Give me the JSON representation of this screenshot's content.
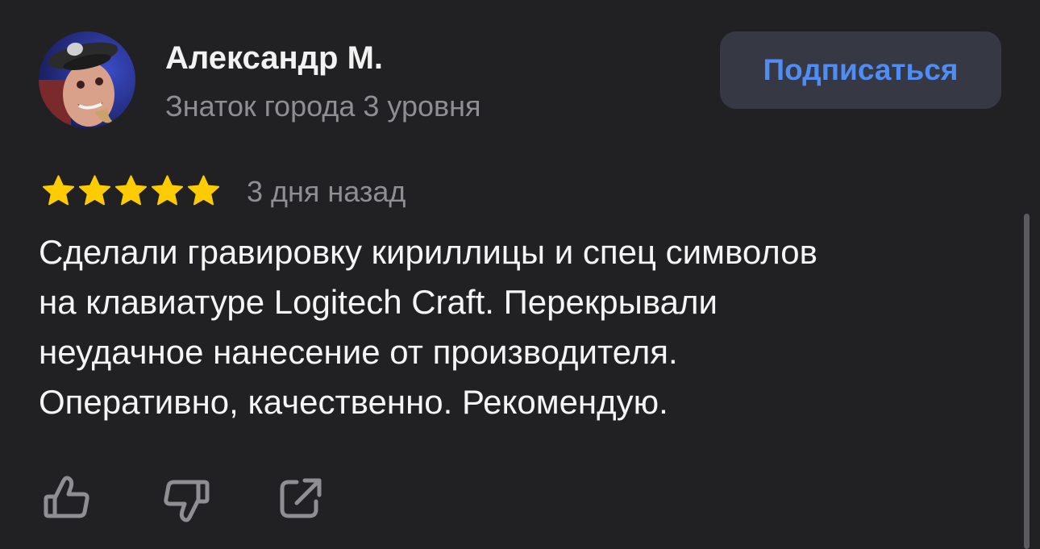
{
  "author": {
    "name": "Александр М.",
    "level": "Знаток города 3 уровня",
    "avatar_icon": "user-avatar-photo"
  },
  "subscribe_button": {
    "label": "Подписаться",
    "color": "#4f8df5"
  },
  "review": {
    "rating": 5,
    "rating_max": 5,
    "star_color": "#fccc00",
    "date": "3 дня назад",
    "text_lines": [
      "Сделали гравировку кириллицы и спец символов",
      "на клавиатуре Logitech Craft. Перекрывали",
      "неудачное нанесение от производителя.",
      "Оперативно, качественно. Рекомендую."
    ]
  },
  "actions": {
    "like_icon": "thumbs-up-icon",
    "dislike_icon": "thumbs-down-icon",
    "share_icon": "share-icon"
  },
  "colors": {
    "background": "#212123",
    "secondary_text": "#8e8e93",
    "button_background": "#363844"
  }
}
